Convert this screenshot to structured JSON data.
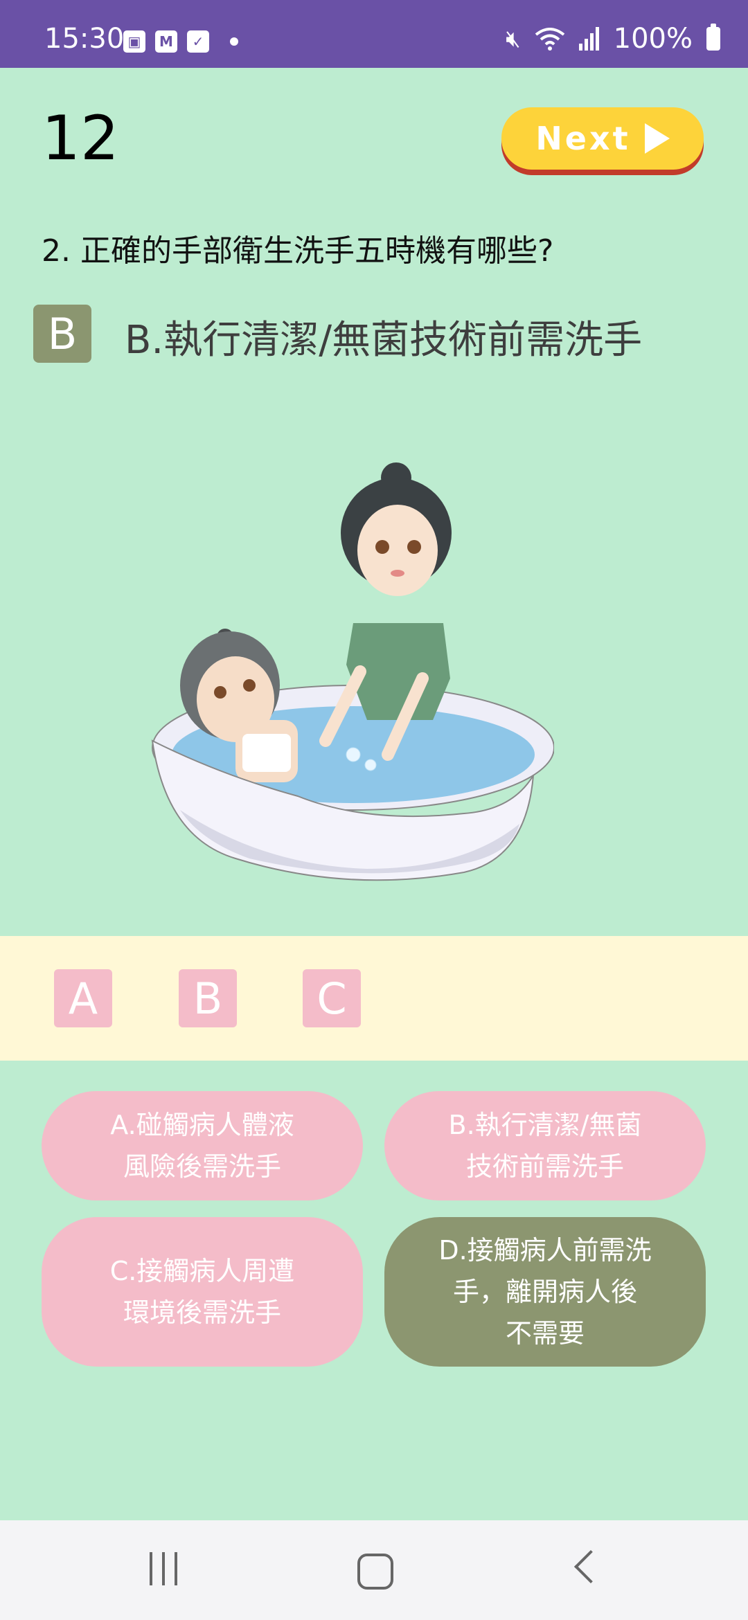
{
  "status_bar": {
    "time": "15:30",
    "battery": "100%",
    "icons_left": [
      "image-icon",
      "gmail-icon",
      "checkbox-icon",
      "dot-icon"
    ],
    "icons_right": [
      "mute-icon",
      "wifi-icon",
      "signal-icon",
      "battery-icon"
    ]
  },
  "score": "12",
  "next_button": {
    "label": "Next"
  },
  "question": "2. 正確的手部衛生洗手五時機有哪些?",
  "selected": {
    "badge": "B",
    "text": "B.執行清潔/無菌技術前需洗手"
  },
  "answer_tiles": [
    "A",
    "B",
    "C"
  ],
  "options": [
    {
      "line1": "A.碰觸病人體液",
      "line2": "風險後需洗手",
      "line3": "",
      "state": "default"
    },
    {
      "line1": "B.執行清潔/無菌",
      "line2": "技術前需洗手",
      "line3": "",
      "state": "default"
    },
    {
      "line1": "C.接觸病人周遭",
      "line2": "環境後需洗手",
      "line3": "",
      "state": "default"
    },
    {
      "line1": "D.接觸病人前需洗",
      "line2": "手，離開病人後",
      "line3": "不需要",
      "state": "selected"
    }
  ],
  "colors": {
    "background": "#bdecd0",
    "status_bar": "#6a51a6",
    "next_button": "#fdd33a",
    "answer_strip": "#fff8d6",
    "pink": "#f4bcc9",
    "olive": "#8c9670"
  },
  "nav": [
    "recent-apps-icon",
    "home-icon",
    "back-icon"
  ]
}
